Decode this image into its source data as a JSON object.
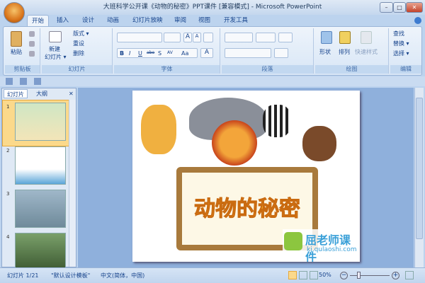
{
  "window": {
    "title": "大班科学公开课《动物的秘密》PPT课件 [兼容模式] - Microsoft PowerPoint",
    "minimize": "–",
    "maximize": "□",
    "close": "✕"
  },
  "tabs": [
    "开始",
    "插入",
    "设计",
    "动画",
    "幻灯片放映",
    "审阅",
    "视图",
    "开发工具"
  ],
  "ribbon": {
    "clipboard": {
      "paste": "粘贴",
      "label": "剪贴板"
    },
    "slides": {
      "new_slide": "新建",
      "new_slide2": "幻灯片 ▾",
      "layout": "版式 ▾",
      "reset": "重设",
      "delete": "删除",
      "label": "幻灯片"
    },
    "font": {
      "bold": "B",
      "italic": "I",
      "underline": "U",
      "strike": "abe",
      "shadow": "S",
      "spacing": "AV",
      "case": "Aa",
      "grow": "A",
      "shrink": "A",
      "color": "A",
      "label": "字体"
    },
    "paragraph": {
      "label": "段落"
    },
    "drawing": {
      "shapes": "形状",
      "arrange": "排列",
      "quick_styles": "快速样式",
      "label": "绘图"
    },
    "editing": {
      "find": "查找",
      "replace": "替换 ▾",
      "select": "选择 ▾",
      "label": "编辑"
    }
  },
  "panel": {
    "tabs": [
      "幻灯片",
      "大纲"
    ],
    "close": "✕",
    "thumbs": [
      "1",
      "2",
      "3",
      "4"
    ]
  },
  "slide": {
    "title": "动物的秘密",
    "watermark_brand": "屈老师课件",
    "watermark_url": "kj.qulaoshi.com"
  },
  "status": {
    "slide": "幻灯片 1/21",
    "theme": "\"默认设计模板\"",
    "lang": "中文(简体，中国)",
    "zoom": "50%",
    "zoom_level": 50
  },
  "colors": {
    "accent": "#15428b",
    "title_text": "#f5a623"
  }
}
